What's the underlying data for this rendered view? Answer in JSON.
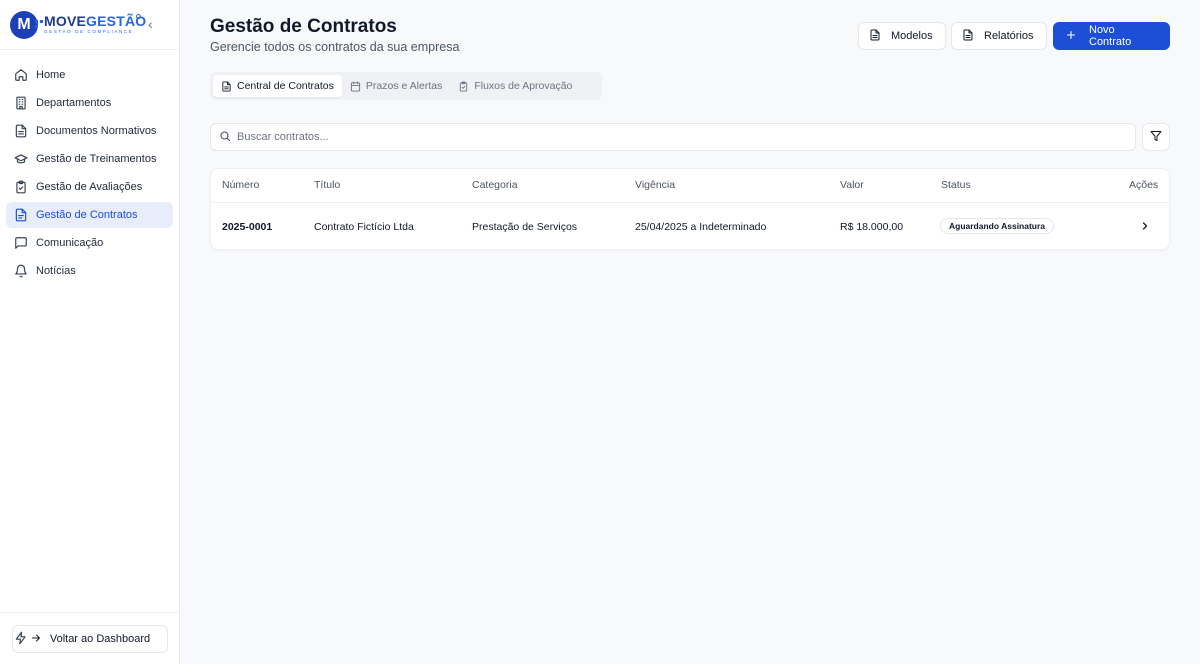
{
  "brand": {
    "name_part1": "MOVE",
    "name_part2": "GESTÃO",
    "tagline": "GESTÃO DE COMPLIANCE",
    "mark_letter": "M"
  },
  "sidebar": {
    "items": [
      {
        "label": "Home",
        "icon": "home-icon"
      },
      {
        "label": "Departamentos",
        "icon": "building-icon"
      },
      {
        "label": "Documentos Normativos",
        "icon": "document-icon"
      },
      {
        "label": "Gestão de Treinamentos",
        "icon": "graduation-cap-icon"
      },
      {
        "label": "Gestão de Avaliações",
        "icon": "clipboard-check-icon"
      },
      {
        "label": "Gestão de Contratos",
        "icon": "contract-icon",
        "active": true
      },
      {
        "label": "Comunicação",
        "icon": "message-icon"
      },
      {
        "label": "Notícias",
        "icon": "bell-icon"
      }
    ],
    "back_label": "Voltar ao Dashboard"
  },
  "header": {
    "title": "Gestão de Contratos",
    "subtitle": "Gerencie todos os contratos da sua empresa",
    "buttons": {
      "modelos": "Modelos",
      "relatorios": "Relatórios",
      "novo": "Novo Contrato"
    }
  },
  "tabs": [
    {
      "label": "Central de Contratos",
      "active": true
    },
    {
      "label": "Prazos e Alertas"
    },
    {
      "label": "Fluxos de Aprovação"
    }
  ],
  "search": {
    "placeholder": "Buscar contratos...",
    "value": ""
  },
  "table": {
    "columns": [
      "Número",
      "Título",
      "Categoria",
      "Vigência",
      "Valor",
      "Status",
      "Ações"
    ],
    "rows": [
      {
        "numero": "2025-0001",
        "titulo": "Contrato Fictício Ltda",
        "categoria": "Prestação de Serviços",
        "vigencia": "25/04/2025 a Indeterminado",
        "valor": "R$ 18.000,00",
        "status": "Aguardando Assinatura"
      }
    ]
  },
  "colors": {
    "primary": "#1d4ed8",
    "active_bg": "#e8edfb",
    "background": "#f8f9fb",
    "border": "#e5e7eb"
  }
}
